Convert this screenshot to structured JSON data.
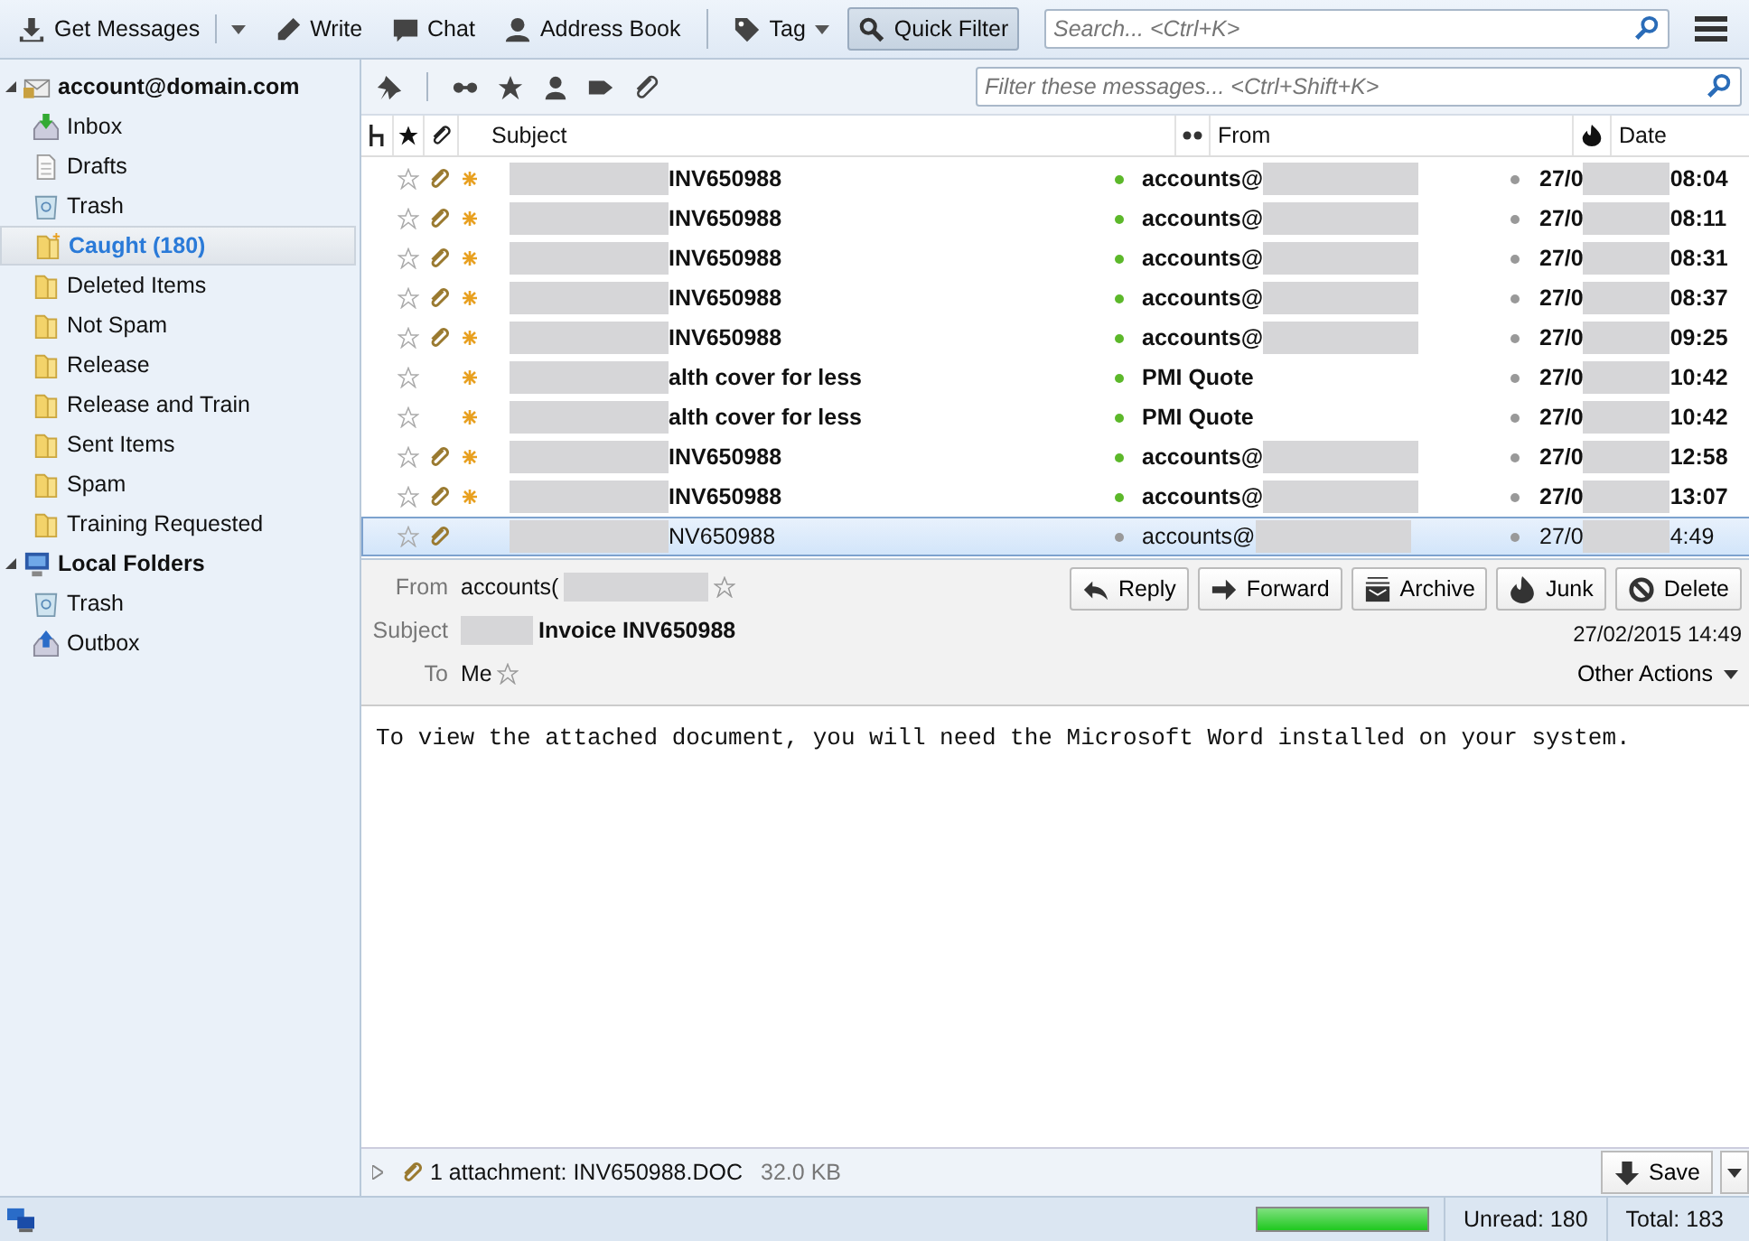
{
  "toolbar": {
    "buttons": [
      {
        "kind": "get",
        "label": "Get Messages",
        "dropdown": true,
        "selected": false
      },
      {
        "kind": "write",
        "label": "Write",
        "dropdown": false,
        "selected": false
      },
      {
        "kind": "chat",
        "label": "Chat",
        "dropdown": false,
        "selected": false
      },
      {
        "kind": "contacts",
        "label": "Address Book",
        "dropdown": false,
        "selected": false
      },
      {
        "kind": "tag",
        "label": "Tag",
        "dropdown": true,
        "selected": false
      },
      {
        "kind": "filter",
        "label": "Quick Filter",
        "dropdown": false,
        "selected": true
      }
    ],
    "search": {
      "placeholder": "Search... <Ctrl+K>"
    }
  },
  "sidebar": {
    "items": [
      {
        "kind": "account",
        "label": "account@domain.com",
        "expanded": true,
        "selected": false,
        "children": [
          {
            "kind": "inbox",
            "label": "Inbox",
            "selected": false
          },
          {
            "kind": "drafts",
            "label": "Drafts",
            "selected": false
          },
          {
            "kind": "trash",
            "label": "Trash",
            "selected": false
          },
          {
            "kind": "folder-new",
            "label": "Caught (180)",
            "selected": true
          },
          {
            "kind": "folder",
            "label": "Deleted Items",
            "selected": false
          },
          {
            "kind": "folder",
            "label": "Not Spam",
            "selected": false
          },
          {
            "kind": "folder",
            "label": "Release",
            "selected": false
          },
          {
            "kind": "folder",
            "label": "Release and Train",
            "selected": false
          },
          {
            "kind": "folder",
            "label": "Sent Items",
            "selected": false
          },
          {
            "kind": "folder",
            "label": "Spam",
            "selected": false
          },
          {
            "kind": "folder",
            "label": "Training Requested",
            "selected": false
          }
        ]
      },
      {
        "kind": "local",
        "label": "Local Folders",
        "expanded": true,
        "selected": false,
        "children": [
          {
            "kind": "trash",
            "label": "Trash",
            "selected": false
          },
          {
            "kind": "outbox",
            "label": "Outbox",
            "selected": false
          }
        ]
      }
    ]
  },
  "quick_filter": {
    "placeholder": "Filter these messages... <Ctrl+Shift+K>"
  },
  "table": {
    "columns": [
      "Subject",
      "From",
      "Date"
    ],
    "rows": [
      {
        "subject": "INV650988",
        "from": "accounts@",
        "date_start": "27/0",
        "date_end": "08:04",
        "starred": false,
        "attachment": true,
        "unread": true,
        "selected": false
      },
      {
        "subject": "INV650988",
        "from": "accounts@",
        "date_start": "27/0",
        "date_end": "08:11",
        "starred": false,
        "attachment": true,
        "unread": true,
        "selected": false
      },
      {
        "subject": "INV650988",
        "from": "accounts@",
        "date_start": "27/0",
        "date_end": "08:31",
        "starred": false,
        "attachment": true,
        "unread": true,
        "selected": false
      },
      {
        "subject": "INV650988",
        "from": "accounts@",
        "date_start": "27/0",
        "date_end": "08:37",
        "starred": false,
        "attachment": true,
        "unread": true,
        "selected": false
      },
      {
        "subject": "INV650988",
        "from": "accounts@",
        "date_start": "27/0",
        "date_end": "09:25",
        "starred": false,
        "attachment": true,
        "unread": true,
        "selected": false
      },
      {
        "subject": "alth cover for less",
        "from": "PMI Quote",
        "date_start": "27/0",
        "date_end": "10:42",
        "starred": false,
        "attachment": false,
        "unread": true,
        "selected": false
      },
      {
        "subject": "alth cover for less",
        "from": "PMI Quote",
        "date_start": "27/0",
        "date_end": "10:42",
        "starred": false,
        "attachment": false,
        "unread": true,
        "selected": false
      },
      {
        "subject": "INV650988",
        "from": "accounts@",
        "date_start": "27/0",
        "date_end": "12:58",
        "starred": false,
        "attachment": true,
        "unread": true,
        "selected": false
      },
      {
        "subject": "INV650988",
        "from": "accounts@",
        "date_start": "27/0",
        "date_end": "13:07",
        "starred": false,
        "attachment": true,
        "unread": true,
        "selected": false
      },
      {
        "subject": "NV650988",
        "from": "accounts@",
        "date_start": "27/0",
        "date_end": "4:49",
        "starred": false,
        "attachment": true,
        "unread": false,
        "selected": true
      }
    ]
  },
  "message": {
    "from_label": "From",
    "from": "accounts(",
    "subject_label": "Subject",
    "subject": "Invoice INV650988",
    "to_label": "To",
    "to": "Me",
    "date": "27/02/2015 14:49",
    "actions": [
      {
        "kind": "reply",
        "label": "Reply"
      },
      {
        "kind": "forward",
        "label": "Forward"
      },
      {
        "kind": "archive",
        "label": "Archive"
      },
      {
        "kind": "junk",
        "label": "Junk"
      },
      {
        "kind": "delete",
        "label": "Delete"
      }
    ],
    "other_actions": "Other Actions",
    "body": "To view the attached document, you will need the Microsoft Word installed on your system."
  },
  "attachments": {
    "summary": "1 attachment: INV650988.DOC",
    "size": "32.0 KB",
    "save": "Save"
  },
  "status_bar": {
    "level": 1,
    "unread": "Unread: 180",
    "total": "Total: 183"
  }
}
